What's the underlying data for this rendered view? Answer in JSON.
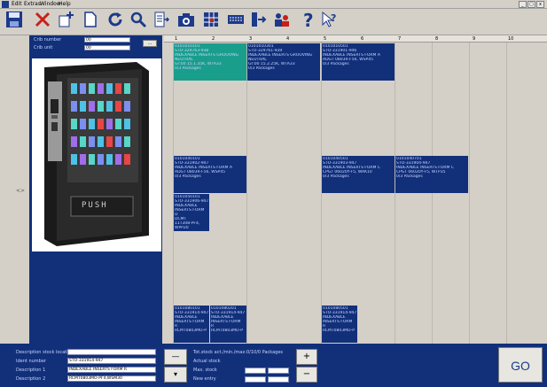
{
  "menu": [
    "Edit",
    "Extras",
    "Window",
    "Help"
  ],
  "window_buttons": [
    "_",
    "□",
    "x"
  ],
  "toolbar": [
    {
      "icon": "save-icon"
    },
    {
      "icon": "delete-icon"
    },
    {
      "icon": "new-item-icon"
    },
    {
      "icon": "new-document-icon"
    },
    {
      "icon": "refresh-icon"
    },
    {
      "icon": "search-icon"
    },
    {
      "icon": "list-icon"
    },
    {
      "icon": "camera-icon"
    },
    {
      "icon": "grid-icon"
    },
    {
      "icon": "keyboard-icon"
    },
    {
      "icon": "transfer-icon"
    },
    {
      "icon": "users-icon"
    },
    {
      "icon": "help-icon"
    },
    {
      "icon": "context-help-icon"
    }
  ],
  "crib": {
    "number_label": "Crib number",
    "number_value": "00",
    "unit_label": "Crib unit",
    "unit_value": "00",
    "button_label": "...",
    "machine_label": "PUSH"
  },
  "grid": {
    "columns": [
      "1",
      "2",
      "3",
      "4",
      "5",
      "6",
      "7",
      "8",
      "9",
      "10"
    ],
    "cells": [
      {
        "id": "0101010101",
        "lines": [
          "0101010101",
          "STO-329763-938",
          "INDEXABLE INSERTS GROOVING",
          "NEUTRAL",
          "Gr:00 15.1.35K, WTA33",
          "0/3 Packages"
        ],
        "selected": true
      },
      {
        "id": "0101010301",
        "lines": [
          "0101010301",
          "STO-329761-939",
          "INDEXABLE INSERTS GROOVING",
          "NEUTRAL",
          "Gr:00 15.2.25K, WTA33",
          "0/3 Packages"
        ],
        "selected": false
      },
      {
        "id": "0101010501",
        "lines": [
          "0101010501",
          "STO-331901-946",
          "INDEXABLE INSERTS FORM A",
          "ADGT 0803R-F56, WSP45",
          "0/3 Packages"
        ],
        "selected": false
      },
      {
        "id": "0101040101",
        "lines": [
          "0101040101",
          "STO-331902-947",
          "INDEXABLE INSERTS FORM A",
          "ADGT 0803R-F56, WSP45",
          "0/3 Packages"
        ],
        "selected": false
      },
      {
        "id": "0101040501",
        "lines": [
          "0101040501",
          "STO-331903-947",
          "INDEXABLE INSERTS FORM C",
          "CPGT 06020Y-F5, WAK10",
          "0/3 Packages"
        ],
        "selected": false
      },
      {
        "id": "0101040701",
        "lines": [
          "0101040701",
          "STO-331904-947",
          "INDEXABLE INSERTS FORM C",
          "CPGT 06020Y-F5, WTP35",
          "0/3 Packages"
        ],
        "selected": false
      },
      {
        "id": "0101050101",
        "lines": [
          "0101050101",
          "STO-331906-947",
          "INDEXABLE",
          "INSERTS FORM",
          "D",
          "DCMT",
          "11T308-PF4,",
          "WPP20"
        ],
        "selected": false
      },
      {
        "id": "0101080101",
        "lines": [
          "0101080101",
          "STO-331914-947",
          "INDEXABLE",
          "INSERTS FORM",
          "R",
          "RCMT0803MO-P"
        ],
        "selected": false
      },
      {
        "id": "0101080201",
        "lines": [
          "0101080201",
          "STO-331914-947",
          "INDEXABLE",
          "INSERTS FORM",
          "R",
          "RCMT0803MO-P"
        ],
        "selected": false
      },
      {
        "id": "0101080501",
        "lines": [
          "0101080501",
          "STO-331914-947",
          "INDEXABLE",
          "INSERTS FORM",
          "R",
          "RCMT0803MO-P"
        ],
        "selected": false
      }
    ]
  },
  "bottom": {
    "desc_location_label": "Description stock location",
    "desc_location_value": "",
    "ident_label": "Ident number",
    "ident_value": "STO-331914-947",
    "desc1_label": "Description 1",
    "desc1_value": "INDEXABLE INSERTS FORM R",
    "desc2_label": "Description 2",
    "desc2_value": "RCMT0803MO-PF4,WSM30",
    "stock_line": "Tot.stock act./min./max:0/10/0 Packages",
    "actual_stock_label": "Actual stock",
    "max_stock_label": "Max. stock",
    "new_entry_label": "New entry",
    "minus_label": "—",
    "dropdown_label": "▾",
    "plus_label": "+",
    "minus2_label": "−",
    "go_label": "GO"
  }
}
